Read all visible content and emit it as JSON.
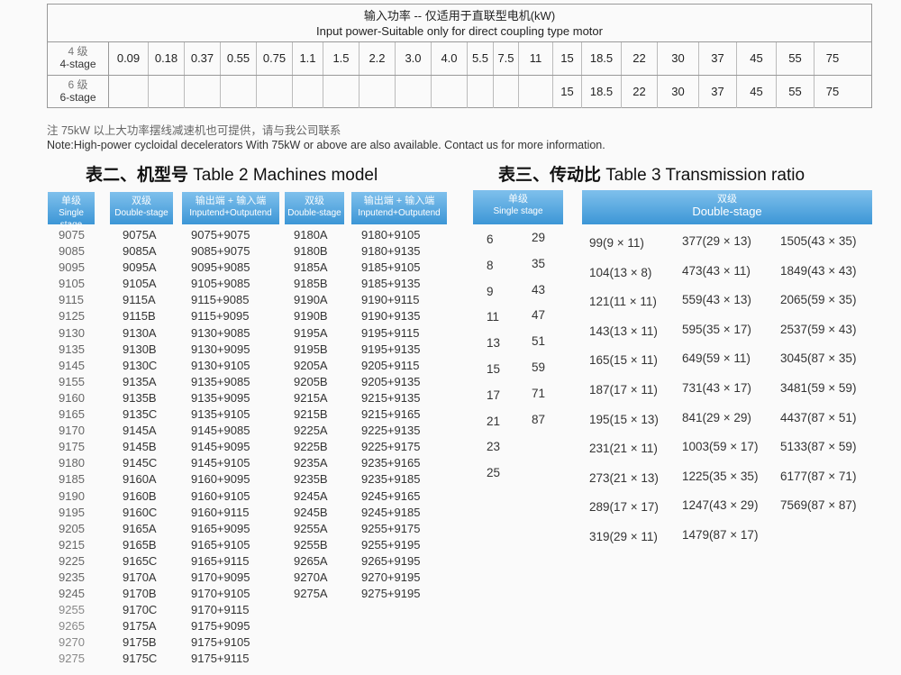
{
  "power_table": {
    "title_cn": "输入功率 -- 仅适用于直联型电机(kW)",
    "title_en": "Input power-Suitable only for direct coupling type motor",
    "row4_cn": "4 级",
    "row4_en": "4-stage",
    "row6_cn": "6 级",
    "row6_en": "6-stage",
    "row4_values": [
      "0.09",
      "0.18",
      "0.37",
      "0.55",
      "0.75",
      "1.1",
      "1.5",
      "2.2",
      "3.0",
      "4.0",
      "5.5",
      "7.5",
      "11",
      "15",
      "18.5",
      "22",
      "30",
      "37",
      "45",
      "55",
      "75"
    ],
    "row6_values": [
      "",
      "",
      "",
      "",
      "",
      "",
      "",
      "",
      "",
      "",
      "",
      "",
      "",
      "15",
      "18.5",
      "22",
      "30",
      "37",
      "45",
      "55",
      "75"
    ]
  },
  "notes": {
    "cn": "注   75kW 以上大功率摆线减速机也可提供，请与我公司联系",
    "en": "Note:High-power cycloidal decelerators With 75kW or above are also available. Contact us for more information."
  },
  "table2": {
    "title_cn": "表二、机型号",
    "title_en": "Table 2 Machines model",
    "h_single_cn": "单级",
    "h_single_en": "Single stage",
    "h_double_cn": "双级",
    "h_double_en": "Double-stage",
    "h_io_cn": "输出端 + 输入端",
    "h_io_en": "Inputend+Outputend",
    "h_double2_cn": "双级",
    "h_double2_en": "Double-stage",
    "h_io2_cn": "输出端 + 输入端",
    "h_io2_en": "Inputend+Outputend",
    "single": [
      "9075",
      "9085",
      "9095",
      "9105",
      "9115",
      "9125",
      "9130",
      "9135",
      "9145",
      "9155",
      "9160",
      "9165",
      "9170",
      "9175",
      "9180",
      "9185",
      "9190",
      "9195",
      "9205",
      "9215",
      "9225",
      "9235",
      "9245",
      "9255",
      "9265",
      "9270",
      "9275"
    ],
    "double1": [
      "9075A",
      "9085A",
      "9095A",
      "9105A",
      "9115A",
      "9115B",
      "9130A",
      "9130B",
      "9130C",
      "9135A",
      "9135B",
      "9135C",
      "9145A",
      "9145B",
      "9145C",
      "9160A",
      "9160B",
      "9160C",
      "9165A",
      "9165B",
      "9165C",
      "9170A",
      "9170B",
      "9170C",
      "9175A",
      "9175B",
      "9175C"
    ],
    "io1": [
      "9075+9075",
      "9085+9075",
      "9095+9085",
      "9105+9085",
      "9115+9085",
      "9115+9095",
      "9130+9085",
      "9130+9095",
      "9130+9105",
      "9135+9085",
      "9135+9095",
      "9135+9105",
      "9145+9085",
      "9145+9095",
      "9145+9105",
      "9160+9095",
      "9160+9105",
      "9160+9115",
      "9165+9095",
      "9165+9105",
      "9165+9115",
      "9170+9095",
      "9170+9105",
      "9170+9115",
      "9175+9095",
      "9175+9105",
      "9175+9115"
    ],
    "double2": [
      "9180A",
      "9180B",
      "9185A",
      "9185B",
      "9190A",
      "9190B",
      "9195A",
      "9195B",
      "9205A",
      "9205B",
      "9215A",
      "9215B",
      "9225A",
      "9225B",
      "9235A",
      "9235B",
      "9245A",
      "9245B",
      "9255A",
      "9255B",
      "9265A",
      "9270A",
      "9275A"
    ],
    "io2": [
      "9180+9105",
      "9180+9135",
      "9185+9105",
      "9185+9135",
      "9190+9115",
      "9190+9135",
      "9195+9115",
      "9195+9135",
      "9205+9115",
      "9205+9135",
      "9215+9135",
      "9215+9165",
      "9225+9135",
      "9225+9175",
      "9235+9165",
      "9235+9185",
      "9245+9165",
      "9245+9185",
      "9255+9175",
      "9255+9195",
      "9265+9195",
      "9270+9195",
      "9275+9195"
    ]
  },
  "table3": {
    "title_cn": "表三、传动比",
    "title_en": "Table 3 Transmission ratio",
    "h_single_cn": "单级",
    "h_single_en": "Single stage",
    "h_double_cn": "双级",
    "h_double_en": "Double-stage",
    "single_a": [
      "6",
      "8",
      "9",
      "11",
      "13",
      "15",
      "17",
      "21",
      "23",
      "25"
    ],
    "single_b": [
      "29",
      "35",
      "43",
      "47",
      "51",
      "59",
      "71",
      "87"
    ],
    "double_c1": [
      "99(9 × 11)",
      "104(13 × 8)",
      "121(11 × 11)",
      "143(13 × 11)",
      "165(15 × 11)",
      "187(17 × 11)",
      "195(15 × 13)",
      "231(21 × 11)",
      "273(21 × 13)",
      "289(17 × 17)",
      "319(29 × 11)"
    ],
    "double_c2": [
      "377(29 × 13)",
      "473(43 × 11)",
      "559(43 × 13)",
      "595(35 × 17)",
      "649(59 × 11)",
      "731(43 × 17)",
      "841(29 × 29)",
      "1003(59 × 17)",
      "1225(35 × 35)",
      "1247(43 × 29)",
      "1479(87 × 17)"
    ],
    "double_c3": [
      "1505(43 × 35)",
      "1849(43 × 43)",
      "2065(59 × 35)",
      "2537(59 × 43)",
      "3045(87 × 35)",
      "3481(59 × 59)",
      "4437(87 × 51)",
      "5133(87 × 59)",
      "6177(87 × 71)",
      "7569(87 × 87)"
    ]
  }
}
